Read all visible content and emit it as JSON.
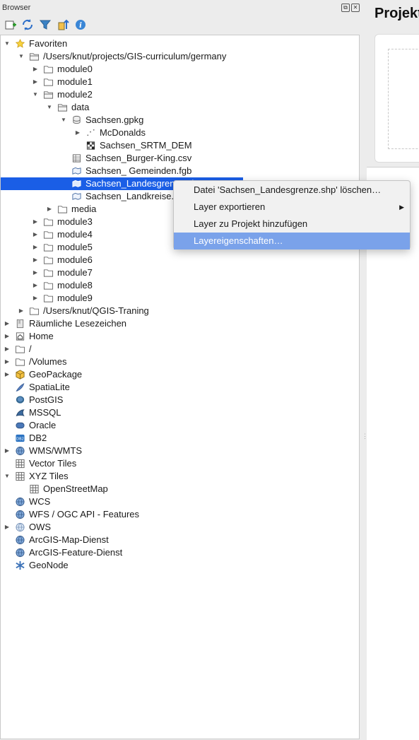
{
  "panel": {
    "title": "Browser",
    "float_symbol": "⧉",
    "close_symbol": "✕"
  },
  "toolbar": [
    {
      "name": "add-selected-layers-icon"
    },
    {
      "name": "refresh-icon"
    },
    {
      "name": "filter-icon"
    },
    {
      "name": "collapse-all-icon"
    },
    {
      "name": "info-icon"
    }
  ],
  "tree": [
    {
      "label": "Favoriten",
      "level": 0,
      "expander": "open",
      "icon": "star"
    },
    {
      "label": "/Users/knut/projects/GIS-curriculum/germany",
      "level": 1,
      "expander": "open",
      "icon": "folder-open"
    },
    {
      "label": "module0",
      "level": 2,
      "expander": "closed",
      "icon": "folder"
    },
    {
      "label": "module1",
      "level": 2,
      "expander": "closed",
      "icon": "folder"
    },
    {
      "label": "module2",
      "level": 2,
      "expander": "open",
      "icon": "folder-open"
    },
    {
      "label": "data",
      "level": 3,
      "expander": "open",
      "icon": "folder-open"
    },
    {
      "label": "Sachsen.gpkg",
      "level": 4,
      "expander": "open",
      "icon": "database"
    },
    {
      "label": "McDonalds",
      "level": 5,
      "expander": "closed",
      "icon": "point-layer"
    },
    {
      "label": "Sachsen_SRTM_DEM",
      "level": 5,
      "expander": "none",
      "icon": "raster"
    },
    {
      "label": "Sachsen_Burger-King.csv",
      "level": 4,
      "expander": "none",
      "icon": "table"
    },
    {
      "label": "Sachsen_ Gemeinden.fgb",
      "level": 4,
      "expander": "none",
      "icon": "polygon"
    },
    {
      "label": "Sachsen_Landesgrenze.shp",
      "level": 4,
      "expander": "none",
      "icon": "polygon",
      "selected": true
    },
    {
      "label": "Sachsen_Landkreise.shp",
      "level": 4,
      "expander": "none",
      "icon": "polygon"
    },
    {
      "label": "media",
      "level": 3,
      "expander": "closed",
      "icon": "folder"
    },
    {
      "label": "module3",
      "level": 2,
      "expander": "closed",
      "icon": "folder"
    },
    {
      "label": "module4",
      "level": 2,
      "expander": "closed",
      "icon": "folder"
    },
    {
      "label": "module5",
      "level": 2,
      "expander": "closed",
      "icon": "folder"
    },
    {
      "label": "module6",
      "level": 2,
      "expander": "closed",
      "icon": "folder"
    },
    {
      "label": "module7",
      "level": 2,
      "expander": "closed",
      "icon": "folder"
    },
    {
      "label": "module8",
      "level": 2,
      "expander": "closed",
      "icon": "folder"
    },
    {
      "label": "module9",
      "level": 2,
      "expander": "closed",
      "icon": "folder"
    },
    {
      "label": "/Users/knut/QGIS-Traning",
      "level": 1,
      "expander": "closed",
      "icon": "folder"
    },
    {
      "label": "Räumliche Lesezeichen",
      "level": 0,
      "expander": "closed",
      "icon": "bookmark"
    },
    {
      "label": "Home",
      "level": 0,
      "expander": "closed",
      "icon": "home"
    },
    {
      "label": "/",
      "level": 0,
      "expander": "closed",
      "icon": "folder"
    },
    {
      "label": "/Volumes",
      "level": 0,
      "expander": "closed",
      "icon": "folder"
    },
    {
      "label": "GeoPackage",
      "level": 0,
      "expander": "closed",
      "icon": "geopackage"
    },
    {
      "label": "SpatiaLite",
      "level": 0,
      "expander": "none",
      "icon": "spatialite"
    },
    {
      "label": "PostGIS",
      "level": 0,
      "expander": "none",
      "icon": "postgis"
    },
    {
      "label": "MSSQL",
      "level": 0,
      "expander": "none",
      "icon": "mssql"
    },
    {
      "label": "Oracle",
      "level": 0,
      "expander": "none",
      "icon": "oracle"
    },
    {
      "label": "DB2",
      "level": 0,
      "expander": "none",
      "icon": "db2"
    },
    {
      "label": "WMS/WMTS",
      "level": 0,
      "expander": "closed",
      "icon": "globe"
    },
    {
      "label": "Vector Tiles",
      "level": 0,
      "expander": "none",
      "icon": "grid"
    },
    {
      "label": "XYZ Tiles",
      "level": 0,
      "expander": "open",
      "icon": "grid"
    },
    {
      "label": "OpenStreetMap",
      "level": 1,
      "expander": "none",
      "icon": "grid"
    },
    {
      "label": "WCS",
      "level": 0,
      "expander": "none",
      "icon": "globe"
    },
    {
      "label": "WFS / OGC API - Features",
      "level": 0,
      "expander": "none",
      "icon": "globe"
    },
    {
      "label": "OWS",
      "level": 0,
      "expander": "closed",
      "icon": "globe-light"
    },
    {
      "label": "ArcGIS-Map-Dienst",
      "level": 0,
      "expander": "none",
      "icon": "globe"
    },
    {
      "label": "ArcGIS-Feature-Dienst",
      "level": 0,
      "expander": "none",
      "icon": "globe"
    },
    {
      "label": "GeoNode",
      "level": 0,
      "expander": "none",
      "icon": "geonode"
    }
  ],
  "context_menu": {
    "items": [
      {
        "label": "Datei 'Sachsen_Landesgrenze.shp' löschen…",
        "submenu": false,
        "highlighted": false
      },
      {
        "label": "Layer exportieren",
        "submenu": true,
        "highlighted": false
      },
      {
        "label": "Layer zu Projekt hinzufügen",
        "submenu": false,
        "highlighted": false
      },
      {
        "label": "Layereigenschaften…",
        "submenu": false,
        "highlighted": true
      }
    ],
    "submenu_symbol": "▶"
  },
  "right_panel": {
    "title": "Projekt"
  },
  "colors": {
    "selection": "#1a5ee6",
    "menu_highlight": "#7aa2ea",
    "folder": "#ffffff",
    "tree_bg": "#ffffff"
  }
}
